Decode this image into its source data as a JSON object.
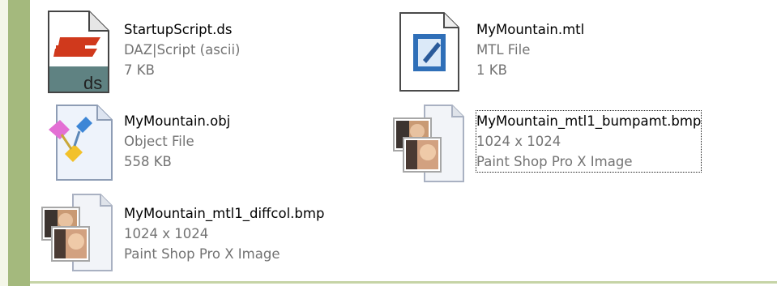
{
  "colors": {
    "sidebar_green": "#a4b97d",
    "name_text": "#000000",
    "meta_text": "#737373"
  },
  "files": [
    {
      "name": "StartupScript.ds",
      "type": "DAZ|Script (ascii)",
      "size": "7 KB",
      "icon": "daz-script-file-icon",
      "icon_label": "ds"
    },
    {
      "name": "MyMountain.mtl",
      "type": "MTL File",
      "size": "1 KB",
      "icon": "mtl-document-icon"
    },
    {
      "name": "MyMountain.obj",
      "type": "Object File",
      "size": "558 KB",
      "icon": "object-file-icon"
    },
    {
      "name": "MyMountain_mtl1_bumpamt.bmp",
      "type": "1024 x 1024",
      "size": "Paint Shop Pro X Image",
      "icon": "bmp-image-file-icon",
      "selected": true
    },
    {
      "name": "MyMountain_mtl1_diffcol.bmp",
      "type": "1024 x 1024",
      "size": "Paint Shop Pro X Image",
      "icon": "bmp-image-file-icon"
    }
  ]
}
